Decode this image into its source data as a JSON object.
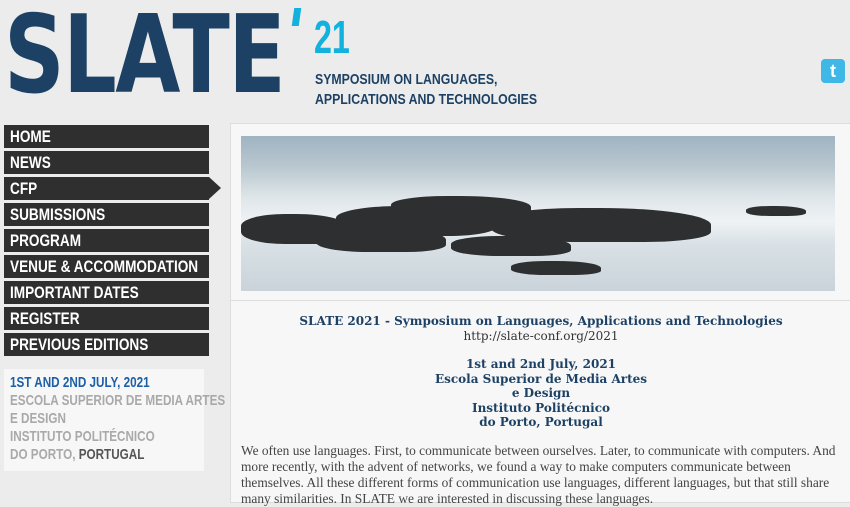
{
  "header": {
    "logo": "SLATE",
    "year": "21",
    "subtitle_line1": "SYMPOSIUM ON LANGUAGES,",
    "subtitle_line2": "APPLICATIONS AND TECHNOLOGIES",
    "twitter_icon": "twitter-icon"
  },
  "nav": [
    "HOME",
    "NEWS",
    "CFP",
    "SUBMISSIONS",
    "PROGRAM",
    "VENUE & ACCOMMODATION",
    "IMPORTANT DATES",
    "REGISTER",
    "PREVIOUS EDITIONS"
  ],
  "info": {
    "date": "1ST AND 2ND JULY, 2021",
    "line1": "ESCOLA SUPERIOR DE MEDIA ARTES",
    "line2": "E DESIGN",
    "line3": "INSTITUTO POLITÉCNICO",
    "line4a": "DO PORTO, ",
    "line4b": "PORTUGAL"
  },
  "content": {
    "title": "SLATE 2021 - Symposium on Languages, Applications and Technologies",
    "url": "http://slate-conf.org/2021",
    "date": "1st and 2nd July, 2021",
    "v1": "Escola Superior de Media Artes",
    "v2": "e Design",
    "v3": "Instituto Politécnico",
    "v4": "do Porto, Portugal",
    "body": "We often use languages. First, to communicate between ourselves. Later, to communicate with computers. And more recently, with the advent of networks, we found a way to make computers communicate between themselves. All these different forms of communication use languages, different languages, but that still share many similarities. In SLATE we are interested in discussing these languages."
  }
}
